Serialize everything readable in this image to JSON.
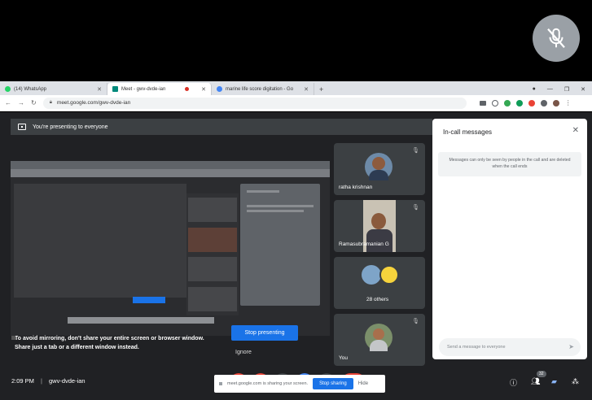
{
  "browser": {
    "tabs": [
      {
        "label": "(14) WhatsApp",
        "color": "#25d366"
      },
      {
        "label": "Meet - gwv-dvde-ian",
        "color": "#00897b"
      },
      {
        "label": "marine life score digitation - Go",
        "color": "#4285f4"
      }
    ],
    "url": "meet.google.com/gwv-dvde-ian"
  },
  "meet": {
    "presenting_banner": "You're presenting to everyone",
    "mirror_warning": "To avoid mirroring, don't share your entire screen or browser window. Share just a tab or a different window instead.",
    "stop_presenting": "Stop presenting",
    "ignore": "Ignore",
    "participants": [
      {
        "name": "ratha krishnan"
      },
      {
        "name": "Ramasubramanian G"
      },
      {
        "name": "28 others"
      },
      {
        "name": "You"
      }
    ]
  },
  "chat": {
    "title": "In-call messages",
    "note": "Messages can only be seen by people in the call and are deleted when the call ends",
    "input_placeholder": "Send a message to everyone"
  },
  "bottom": {
    "time": "2:09 PM",
    "separator": "|",
    "meeting_code": "gwv-dvde-ian",
    "share_notice": "meet.google.com is sharing your screen.",
    "stop_sharing": "Stop sharing",
    "hide": "Hide",
    "people_count": "32"
  }
}
